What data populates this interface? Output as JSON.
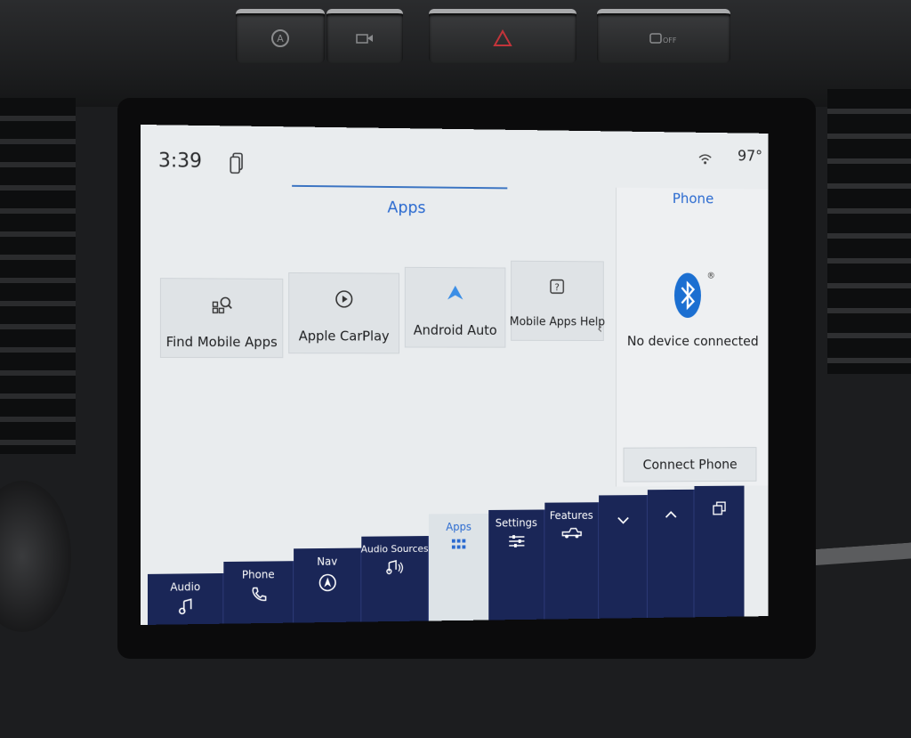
{
  "status": {
    "time": "3:39",
    "temperature": "97°"
  },
  "apps": {
    "title": "Apps",
    "tiles": [
      {
        "label": "Find Mobile Apps",
        "icon": "app-search-icon"
      },
      {
        "label": "Apple CarPlay",
        "icon": "carplay-icon"
      },
      {
        "label": "Android Auto",
        "icon": "android-auto-icon"
      },
      {
        "label": "Mobile Apps Help",
        "icon": "help-icon"
      }
    ]
  },
  "phone_panel": {
    "title": "Phone",
    "bluetooth_mark": "®",
    "status": "No device connected",
    "connect_label": "Connect Phone"
  },
  "nav": {
    "items": [
      {
        "label": "Audio",
        "icon": "music-note-icon"
      },
      {
        "label": "Phone",
        "icon": "phone-handset-icon"
      },
      {
        "label": "Nav",
        "icon": "navigation-icon"
      },
      {
        "label": "Audio Sources",
        "icon": "audio-sources-icon"
      },
      {
        "label": "Apps",
        "icon": "apps-grid-icon",
        "active": true
      },
      {
        "label": "Settings",
        "icon": "sliders-icon"
      },
      {
        "label": "Features",
        "icon": "truck-icon"
      },
      {
        "label": "",
        "icon": "chevron-down-icon"
      },
      {
        "label": "",
        "icon": "chevron-up-icon"
      },
      {
        "label": "",
        "icon": "multi-window-icon"
      }
    ]
  },
  "colors": {
    "accent": "#2a6ad0",
    "nav_bg": "#1a2657",
    "screen_bg": "#e9ecee"
  }
}
